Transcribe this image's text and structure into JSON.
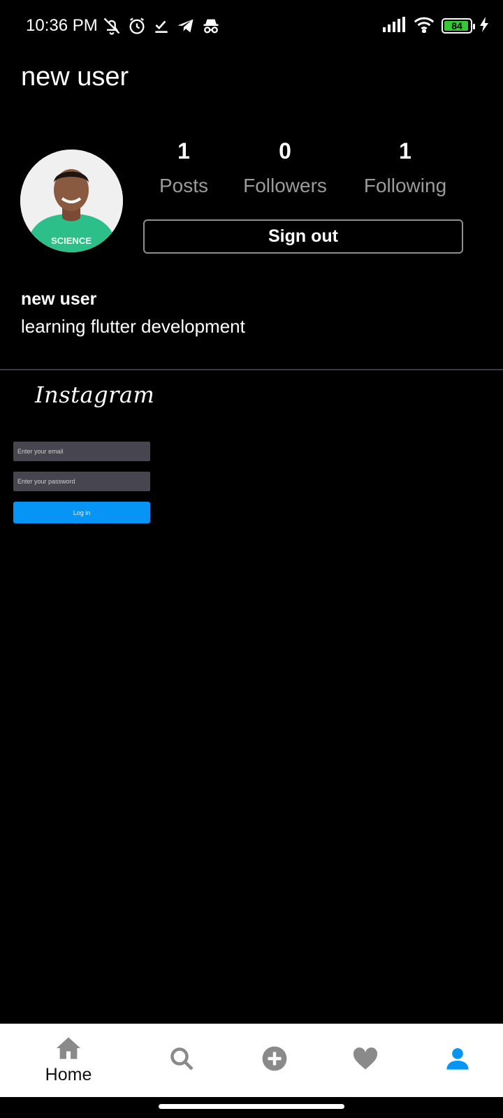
{
  "status_bar": {
    "time": "10:36 PM",
    "battery_level": "84",
    "icons": [
      "bell-off-icon",
      "alarm-icon",
      "check-icon",
      "telegram-icon",
      "incognito-icon",
      "signal-icon",
      "wifi-icon",
      "battery-icon",
      "charging-icon"
    ]
  },
  "profile": {
    "username": "new user",
    "stats": [
      {
        "value": "1",
        "label": "Posts"
      },
      {
        "value": "0",
        "label": "Followers"
      },
      {
        "value": "1",
        "label": "Following"
      }
    ],
    "sign_out_label": "Sign out",
    "bio_name": "new user",
    "bio_text": "learning flutter development"
  },
  "login": {
    "logo": "Instagram",
    "email_placeholder": "Enter your email",
    "password_placeholder": "Enter your password",
    "login_label": "Log in"
  },
  "bottom_nav": {
    "items": [
      {
        "icon": "home-icon",
        "label": "Home"
      },
      {
        "icon": "search-icon",
        "label": ""
      },
      {
        "icon": "add-circle-icon",
        "label": ""
      },
      {
        "icon": "heart-icon",
        "label": ""
      },
      {
        "icon": "person-icon",
        "label": ""
      }
    ],
    "inactive_color": "#8a8a8a",
    "active_color": "#0795f5"
  }
}
